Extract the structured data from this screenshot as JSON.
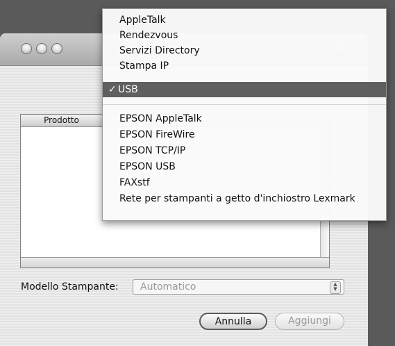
{
  "window": {
    "column_header": "Prodotto",
    "model_label": "Modello Stampante:",
    "model_value": "Automatico",
    "buttons": {
      "cancel": "Annulla",
      "add": "Aggiungi"
    }
  },
  "menu": {
    "check_mark": "✓",
    "group1": [
      "AppleTalk",
      "Rendezvous",
      "Servizi Directory",
      "Stampa IP",
      "USB"
    ],
    "selected": "USB",
    "group2": [
      "EPSON AppleTalk",
      "EPSON FireWire",
      "EPSON TCP/IP",
      "EPSON USB",
      "FAXstf",
      "Rete per stampanti a getto d'inchiostro Lexmark"
    ]
  }
}
